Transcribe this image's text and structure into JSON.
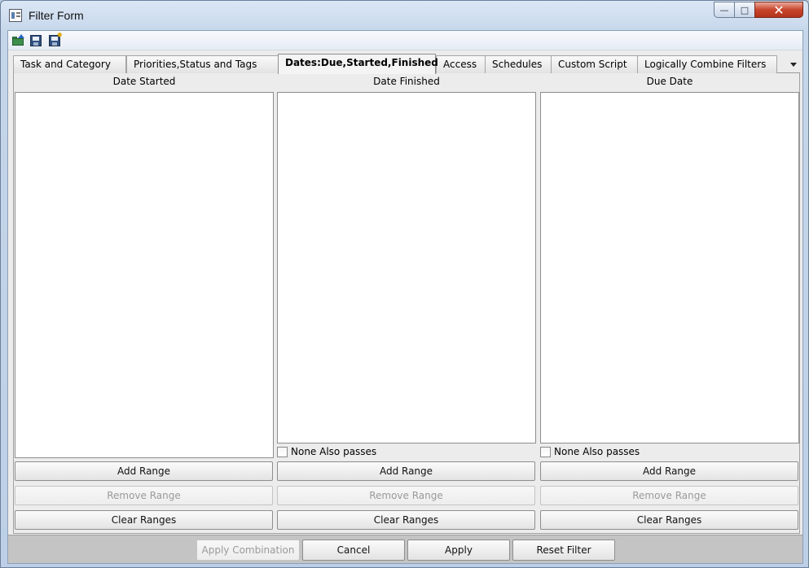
{
  "window": {
    "title": "Filter Form",
    "buttons": {
      "minimize": "—",
      "maximize": "□",
      "close": "✕"
    }
  },
  "toolbar": {
    "icons": [
      "open-icon",
      "save-icon",
      "save-as-icon"
    ]
  },
  "tabs": [
    {
      "label": "Task and Category",
      "active": false
    },
    {
      "label": "Priorities,Status and Tags",
      "active": false
    },
    {
      "label": "Dates:Due,Started,Finished",
      "active": true
    },
    {
      "label": "Access",
      "active": false
    },
    {
      "label": "Schedules",
      "active": false
    },
    {
      "label": "Custom Script",
      "active": false
    },
    {
      "label": "Logically Combine Filters",
      "active": false
    }
  ],
  "columns": [
    {
      "title": "Date Started",
      "add_label": "Add Range",
      "remove_label": "Remove Range",
      "clear_label": "Clear Ranges"
    },
    {
      "title": "Date Finished",
      "none_passes_label": "None Also passes",
      "none_passes_checked": false,
      "add_label": "Add Range",
      "remove_label": "Remove Range",
      "clear_label": "Clear Ranges"
    },
    {
      "title": "Due Date",
      "none_passes_label": "None Also passes",
      "none_passes_checked": false,
      "add_label": "Add Range",
      "remove_label": "Remove Range",
      "clear_label": "Clear Ranges"
    }
  ],
  "bottom": {
    "apply_combination_label": "Apply Combination",
    "cancel_label": "Cancel",
    "apply_label": "Apply",
    "reset_label": "Reset Filter"
  }
}
